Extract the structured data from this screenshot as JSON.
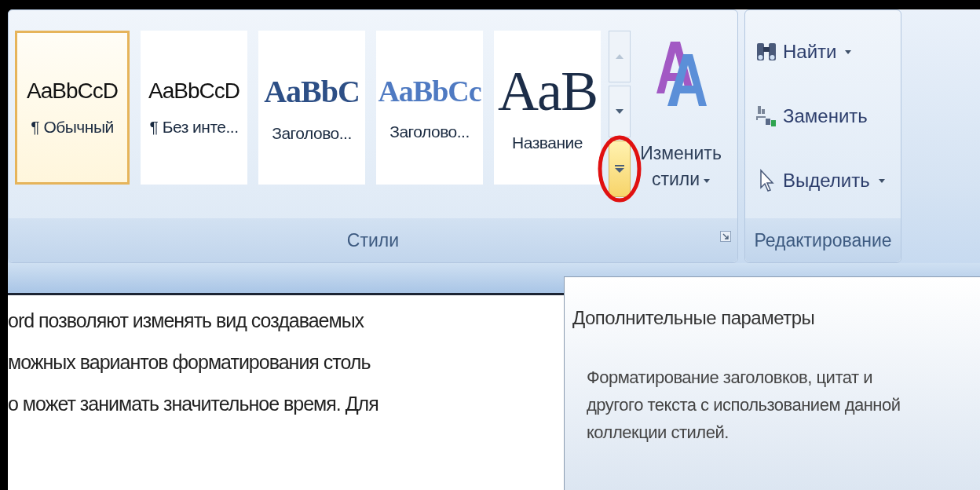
{
  "styles_group": {
    "label": "Стили",
    "gallery": [
      {
        "kind": "normal",
        "sample": "AaBbCcD",
        "label": "¶ Обычный",
        "selected": true
      },
      {
        "kind": "normal",
        "sample": "AaBbCcD",
        "label": "¶ Без инте...",
        "selected": false
      },
      {
        "kind": "heading1",
        "sample": "AaBbC",
        "label": "Заголово...",
        "selected": false
      },
      {
        "kind": "heading2",
        "sample": "AaBbCc",
        "label": "Заголово...",
        "selected": false
      },
      {
        "kind": "title",
        "sample": "AaB",
        "label": "Название",
        "selected": false
      }
    ],
    "more_button": {
      "highlighted": true
    },
    "change_styles": {
      "label": "Изменить стили"
    }
  },
  "editing_group": {
    "label": "Редактирование",
    "commands": [
      {
        "kind": "find",
        "label": "Найти",
        "dropdown": true
      },
      {
        "kind": "replace",
        "label": "Заменить",
        "dropdown": false
      },
      {
        "kind": "select",
        "label": "Выделить",
        "dropdown": true
      }
    ]
  },
  "document": {
    "lines": [
      "ord позволяют изменять вид создаваемых",
      "можных вариантов форматирования столь",
      "о может занимать значительное время. Для"
    ]
  },
  "tooltip": {
    "title": "Дополнительные параметры",
    "body": "Форматирование заголовков, цитат и другого текста с использованием данной коллекции стилей."
  }
}
